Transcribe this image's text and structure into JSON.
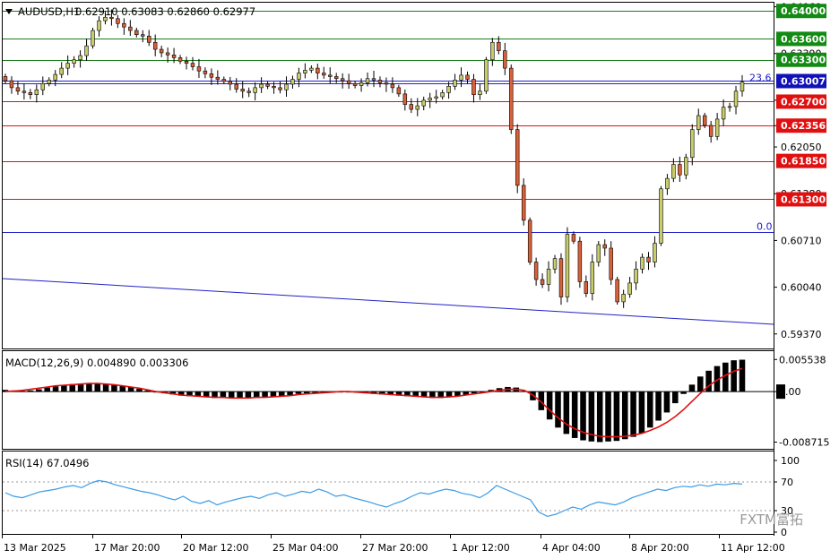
{
  "header": {
    "symbol": "AUDUSD,H1",
    "ohlc": "0.62910 0.63083 0.62860 0.62977",
    "macd": "MACD(12,26,9) 0.004890 0.003306",
    "rsi": "RSI(14) 67.0496"
  },
  "watermark": "FXTM富拓",
  "colors": {
    "bull": "#c8cc6a",
    "bear": "#d9623a",
    "green_line": "#1a7a1a",
    "red_line": "#e01010",
    "blue_line": "#2020c8",
    "macd_signal": "#e01010",
    "rsi_line": "#3a9be8",
    "green_tag": "#138a13",
    "red_tag": "#e01010",
    "blue_tag": "#1111b8"
  },
  "chart_data": {
    "type": "candlestick",
    "price_axis": {
      "ylim": [
        0.592,
        0.6408
      ],
      "tick_labels": [
        "0.64060",
        "0.63390",
        "0.62720",
        "0.62356",
        "0.62050",
        "0.61380",
        "0.60710",
        "0.60040",
        "0.59370"
      ]
    },
    "x_tick_labels": [
      "13 Mar 2025",
      "17 Mar 20:00",
      "20 Mar 12:00",
      "25 Mar 04:00",
      "27 Mar 20:00",
      "1 Apr 12:00",
      "4 Apr 04:00",
      "8 Apr 20:00",
      "11 Apr 12:00"
    ],
    "levels": [
      {
        "value": 0.64,
        "label": "0.64000",
        "kind": "green"
      },
      {
        "value": 0.636,
        "label": "0.63600",
        "kind": "green"
      },
      {
        "value": 0.633,
        "label": "0.63300",
        "kind": "green"
      },
      {
        "value": 0.627,
        "label": "0.62700",
        "kind": "red"
      },
      {
        "value": 0.62356,
        "label": "0.62356",
        "kind": "red"
      },
      {
        "value": 0.6185,
        "label": "0.61850",
        "kind": "red"
      },
      {
        "value": 0.613,
        "label": "0.61300",
        "kind": "red"
      }
    ],
    "price_tag": {
      "value": 0.63007,
      "label": "0.63007"
    },
    "fib_labels": [
      {
        "value": 0.6301,
        "label": "23.6"
      },
      {
        "value": 0.6083,
        "label": "0.0"
      }
    ],
    "closes": [
      0.63,
      0.629,
      0.6285,
      0.6283,
      0.628,
      0.6287,
      0.6296,
      0.6301,
      0.6309,
      0.6318,
      0.6325,
      0.633,
      0.6336,
      0.635,
      0.6372,
      0.6386,
      0.6391,
      0.6389,
      0.6382,
      0.6377,
      0.6372,
      0.6366,
      0.6364,
      0.6355,
      0.6345,
      0.634,
      0.6337,
      0.6333,
      0.6328,
      0.6325,
      0.632,
      0.6314,
      0.631,
      0.6305,
      0.6302,
      0.6299,
      0.6295,
      0.6288,
      0.6285,
      0.6283,
      0.629,
      0.6295,
      0.6292,
      0.629,
      0.6287,
      0.6295,
      0.6302,
      0.6311,
      0.6315,
      0.6318,
      0.6311,
      0.6308,
      0.6306,
      0.6303,
      0.63,
      0.6296,
      0.6293,
      0.6297,
      0.6303,
      0.6301,
      0.6297,
      0.6295,
      0.629,
      0.6281,
      0.6266,
      0.6259,
      0.6264,
      0.6272,
      0.6275,
      0.6277,
      0.6283,
      0.6292,
      0.6301,
      0.6308,
      0.6302,
      0.628,
      0.6285,
      0.633,
      0.6355,
      0.6343,
      0.6318,
      0.623,
      0.615,
      0.61,
      0.604,
      0.6015,
      0.6008,
      0.603,
      0.6045,
      0.599,
      0.608,
      0.607,
      0.6012,
      0.5995,
      0.604,
      0.6065,
      0.606,
      0.6015,
      0.5983,
      0.5994,
      0.601,
      0.603,
      0.6047,
      0.604,
      0.6067,
      0.6145,
      0.616,
      0.618,
      0.6165,
      0.619,
      0.623,
      0.625,
      0.6236,
      0.622,
      0.6245,
      0.6262,
      0.6263,
      0.6285,
      0.6298
    ],
    "macd": {
      "ylim": [
        -0.0094,
        0.0062
      ],
      "tick_labels": [
        "0.005538",
        "0.00",
        "-0.008715"
      ],
      "signal": [
        0.0,
        0.0001,
        0.0002,
        0.0004,
        0.0006,
        0.0008,
        0.001,
        0.0011,
        0.0012,
        0.0013,
        0.0014,
        0.0014,
        0.0013,
        0.0012,
        0.001,
        0.0008,
        0.0006,
        0.0003,
        0.0,
        -0.0002,
        -0.0004,
        -0.0006,
        -0.0007,
        -0.0008,
        -0.0009,
        -0.001,
        -0.001,
        -0.0011,
        -0.0011,
        -0.0011,
        -0.001,
        -0.001,
        -0.0009,
        -0.0008,
        -0.0007,
        -0.0005,
        -0.0004,
        -0.0003,
        -0.0002,
        -0.0001,
        0.0,
        0.0,
        -0.0001,
        -0.0002,
        -0.0003,
        -0.0004,
        -0.0005,
        -0.0006,
        -0.0007,
        -0.0008,
        -0.0009,
        -0.001,
        -0.001,
        -0.0009,
        -0.0008,
        -0.0006,
        -0.0004,
        -0.0002,
        0.0,
        0.0002,
        0.0004,
        0.0004,
        0.0002,
        -0.0006,
        -0.0018,
        -0.0032,
        -0.0045,
        -0.0056,
        -0.0064,
        -0.007,
        -0.0074,
        -0.0077,
        -0.0078,
        -0.0078,
        -0.0077,
        -0.0075,
        -0.0072,
        -0.0067,
        -0.0061,
        -0.0053,
        -0.0043,
        -0.0031,
        -0.0017,
        -0.0003,
        0.001,
        0.002,
        0.0028,
        0.0035,
        0.004
      ],
      "histogram": [
        0.0003,
        0.0002,
        0.0001,
        0.0002,
        0.0004,
        0.0007,
        0.0009,
        0.0011,
        0.0013,
        0.0014,
        0.0015,
        0.0015,
        0.0014,
        0.0012,
        0.001,
        0.0008,
        0.0005,
        0.0002,
        -0.0001,
        -0.0003,
        -0.0005,
        -0.0007,
        -0.0008,
        -0.0009,
        -0.001,
        -0.0011,
        -0.0011,
        -0.0012,
        -0.0012,
        -0.0012,
        -0.0011,
        -0.001,
        -0.0009,
        -0.0008,
        -0.0006,
        -0.0004,
        -0.0003,
        -0.0002,
        -0.0001,
        0.0,
        0.0,
        -0.0001,
        -0.0002,
        -0.0003,
        -0.0004,
        -0.0005,
        -0.0006,
        -0.0007,
        -0.0008,
        -0.0009,
        -0.001,
        -0.0011,
        -0.0011,
        -0.001,
        -0.0008,
        -0.0006,
        -0.0003,
        0.0,
        0.0003,
        0.0006,
        0.0008,
        0.0007,
        0.0001,
        -0.0015,
        -0.0032,
        -0.0048,
        -0.0062,
        -0.0073,
        -0.008,
        -0.0084,
        -0.0086,
        -0.0087,
        -0.0086,
        -0.0085,
        -0.0082,
        -0.0078,
        -0.0072,
        -0.0062,
        -0.005,
        -0.0036,
        -0.002,
        -0.0004,
        0.0012,
        0.0026,
        0.0036,
        0.0044,
        0.005,
        0.0054,
        0.0055
      ]
    },
    "rsi": {
      "ylim": [
        0,
        100
      ],
      "tick_labels": [
        "100",
        "70",
        "30",
        "0"
      ],
      "values": [
        55,
        50,
        48,
        52,
        56,
        58,
        60,
        63,
        65,
        62,
        68,
        72,
        70,
        66,
        63,
        60,
        57,
        55,
        52,
        48,
        45,
        50,
        43,
        40,
        44,
        38,
        42,
        45,
        48,
        50,
        47,
        52,
        55,
        50,
        53,
        57,
        55,
        60,
        56,
        50,
        52,
        48,
        45,
        42,
        38,
        35,
        40,
        44,
        50,
        55,
        53,
        57,
        60,
        58,
        54,
        52,
        48,
        55,
        65,
        60,
        55,
        50,
        45,
        28,
        22,
        25,
        30,
        35,
        32,
        38,
        42,
        40,
        38,
        42,
        48,
        52,
        56,
        60,
        58,
        62,
        64,
        63,
        66,
        64,
        67,
        66,
        68,
        67
      ]
    }
  }
}
